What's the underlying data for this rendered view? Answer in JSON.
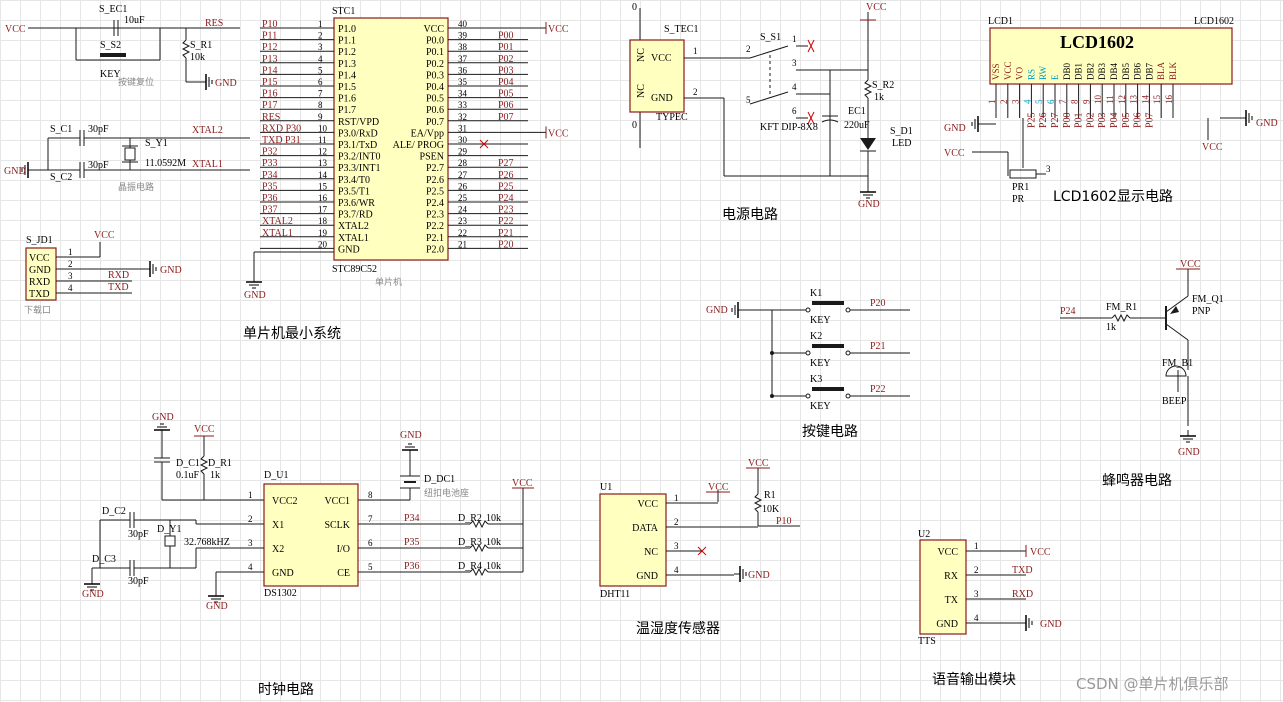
{
  "sections": {
    "mcu": "单片机最小系统",
    "power": "电源电路",
    "keys": "按键电路",
    "lcd": "LCD1602显示电路",
    "buzzer": "蜂鸣器电路",
    "clock": "时钟电路",
    "dht": "温湿度传感器",
    "tts": "语音输出模块"
  },
  "mcu": {
    "ref": "STC1",
    "part": "STC89C52",
    "part_note": "单片机",
    "left_pins": [
      {
        "num": "1",
        "name": "P1.0",
        "net": "P10"
      },
      {
        "num": "2",
        "name": "P1.1",
        "net": "P11"
      },
      {
        "num": "3",
        "name": "P1.2",
        "net": "P12"
      },
      {
        "num": "4",
        "name": "P1.3",
        "net": "P13"
      },
      {
        "num": "5",
        "name": "P1.4",
        "net": "P14"
      },
      {
        "num": "6",
        "name": "P1.5",
        "net": "P15"
      },
      {
        "num": "7",
        "name": "P1.6",
        "net": "P16"
      },
      {
        "num": "8",
        "name": "P1.7",
        "net": "P17"
      },
      {
        "num": "9",
        "name": "RST/VPD",
        "net": "RES"
      },
      {
        "num": "10",
        "name": "P3.0/RxD",
        "net": "RXD P30"
      },
      {
        "num": "11",
        "name": "P3.1/TxD",
        "net": "TXD P31"
      },
      {
        "num": "12",
        "name": "P3.2/INT0",
        "net": "P32"
      },
      {
        "num": "13",
        "name": "P3.3/INT1",
        "net": "P33"
      },
      {
        "num": "14",
        "name": "P3.4/T0",
        "net": "P34"
      },
      {
        "num": "15",
        "name": "P3.5/T1",
        "net": "P35"
      },
      {
        "num": "16",
        "name": "P3.6/WR",
        "net": "P36"
      },
      {
        "num": "17",
        "name": "P3.7/RD",
        "net": "P37"
      },
      {
        "num": "18",
        "name": "XTAL2",
        "net": "XTAL2"
      },
      {
        "num": "19",
        "name": "XTAL1",
        "net": "XTAL1"
      },
      {
        "num": "20",
        "name": "GND",
        "net": ""
      }
    ],
    "right_pins": [
      {
        "num": "40",
        "name": "VCC",
        "net": "VCC"
      },
      {
        "num": "39",
        "name": "P0.0",
        "net": "P00"
      },
      {
        "num": "38",
        "name": "P0.1",
        "net": "P01"
      },
      {
        "num": "37",
        "name": "P0.2",
        "net": "P02"
      },
      {
        "num": "36",
        "name": "P0.3",
        "net": "P03"
      },
      {
        "num": "35",
        "name": "P0.4",
        "net": "P04"
      },
      {
        "num": "34",
        "name": "P0.5",
        "net": "P05"
      },
      {
        "num": "33",
        "name": "P0.6",
        "net": "P06"
      },
      {
        "num": "32",
        "name": "P0.7",
        "net": "P07"
      },
      {
        "num": "31",
        "name": "EA/Vpp",
        "net": "VCC"
      },
      {
        "num": "30",
        "name": "ALE/ PROG",
        "net": ""
      },
      {
        "num": "29",
        "name": "PSEN",
        "net": ""
      },
      {
        "num": "28",
        "name": "P2.7",
        "net": "P27"
      },
      {
        "num": "27",
        "name": "P2.6",
        "net": "P26"
      },
      {
        "num": "26",
        "name": "P2.5",
        "net": "P25"
      },
      {
        "num": "25",
        "name": "P2.4",
        "net": "P24"
      },
      {
        "num": "24",
        "name": "P2.3",
        "net": "P23"
      },
      {
        "num": "23",
        "name": "P2.2",
        "net": "P22"
      },
      {
        "num": "22",
        "name": "P2.1",
        "net": "P21"
      },
      {
        "num": "21",
        "name": "P2.0",
        "net": "P20"
      }
    ]
  },
  "reset": {
    "vcc": "VCC",
    "cap": "S_EC1",
    "cap_val": "10uF",
    "key": "S_S2",
    "key_val": "KEY",
    "res": "S_R1",
    "res_val": "10k",
    "gnd": "GND",
    "net": "RES",
    "note": "按键复位"
  },
  "crystal": {
    "c1": "S_C1",
    "c2": "S_C2",
    "cval": "30pF",
    "y": "S_Y1",
    "freq": "11.0592M",
    "x2": "XTAL2",
    "x1": "XTAL1",
    "gnd": "GND",
    "note": "晶振电路"
  },
  "download": {
    "ref": "S_JD1",
    "pins": [
      "VCC",
      "GND",
      "RXD",
      "TXD"
    ],
    "nums": [
      "1",
      "2",
      "3",
      "4"
    ],
    "vcc": "VCC",
    "gnd": "GND",
    "rxd": "RXD",
    "txd": "TXD",
    "note": "下载口"
  },
  "power": {
    "conn": "S_TEC1",
    "conn_type": "TYPEC",
    "nc": "NC",
    "vcc": "VCC",
    "gnd": "GND",
    "switch": "S_S1",
    "switch_type": "KFT DIP-8X8",
    "cap": "EC1",
    "cap_val": "220uF",
    "res": "S_R2",
    "res_val": "1k",
    "led": "S_D1",
    "led_type": "LED",
    "zero": "0",
    "n1": "1",
    "n2": "2",
    "n3": "3",
    "n4": "4",
    "n5": "5",
    "n6": "6"
  },
  "keys": {
    "gnd": "GND",
    "k1": "K1",
    "k2": "K2",
    "k3": "K3",
    "kv": "KEY",
    "p1": "P20",
    "p2": "P21",
    "p3": "P22"
  },
  "lcd": {
    "ref": "LCD1",
    "title": "LCD1602",
    "pins": [
      "VSS",
      "VCC",
      "VO",
      "RS",
      "RW",
      "E",
      "DB0",
      "DB1",
      "DB2",
      "DB3",
      "DB4",
      "DB5",
      "DB6",
      "DB7",
      "BLA",
      "BLK"
    ],
    "nets": [
      "",
      "",
      "",
      "P25",
      "P26",
      "P27",
      "P00",
      "P01",
      "P02",
      "P03",
      "P04",
      "P05",
      "P06",
      "P07",
      "",
      ""
    ],
    "gnd": "GND",
    "vcc": "VCC",
    "pr": "PR1",
    "prv": "PR",
    "n3": "3"
  },
  "buzzer": {
    "vcc": "VCC",
    "net": "P24",
    "res": "FM_R1",
    "res_val": "1k",
    "q": "FM_Q1",
    "q_type": "PNP",
    "b": "FM_B1",
    "b_type": "BEEP",
    "gnd": "GND"
  },
  "clock": {
    "gnd": "GND",
    "vcc": "VCC",
    "c1": "D_C1",
    "c1v": "0.1uF",
    "r1": "D_R1",
    "r1v": "1k",
    "u": "D_U1",
    "part": "DS1302",
    "c2": "D_C2",
    "c3": "D_C3",
    "cv": "30pF",
    "y": "D_Y1",
    "freq": "32.768kHZ",
    "bat": "D_DC1",
    "bat_note": "纽扣电池座",
    "pins_l": [
      {
        "n": "1",
        "name": "VCC2"
      },
      {
        "n": "2",
        "name": "X1"
      },
      {
        "n": "3",
        "name": "X2"
      },
      {
        "n": "4",
        "name": "GND"
      }
    ],
    "pins_r": [
      {
        "n": "8",
        "name": "VCC1"
      },
      {
        "n": "7",
        "name": "SCLK"
      },
      {
        "n": "6",
        "name": "I/O"
      },
      {
        "n": "5",
        "name": "CE"
      }
    ],
    "nets": [
      "P34",
      "P35",
      "P36"
    ],
    "rs": [
      "D_R2",
      "D_R3",
      "D_R4"
    ],
    "rv": "10k"
  },
  "dht": {
    "ref": "U1",
    "part": "DHT11",
    "vcc": "VCC",
    "gnd": "GND",
    "res": "R1",
    "res_val": "10K",
    "net": "P10",
    "pins": [
      {
        "n": "1",
        "name": "VCC"
      },
      {
        "n": "2",
        "name": "DATA"
      },
      {
        "n": "3",
        "name": "NC"
      },
      {
        "n": "4",
        "name": "GND"
      }
    ]
  },
  "tts": {
    "ref": "U2",
    "part": "TTS",
    "pins": [
      {
        "n": "1",
        "name": "VCC",
        "net": "VCC"
      },
      {
        "n": "2",
        "name": "RX",
        "net": "TXD"
      },
      {
        "n": "3",
        "name": "TX",
        "net": "RXD"
      },
      {
        "n": "4",
        "name": "GND",
        "net": "GND"
      }
    ]
  },
  "watermark": "CSDN @单片机俱乐部"
}
